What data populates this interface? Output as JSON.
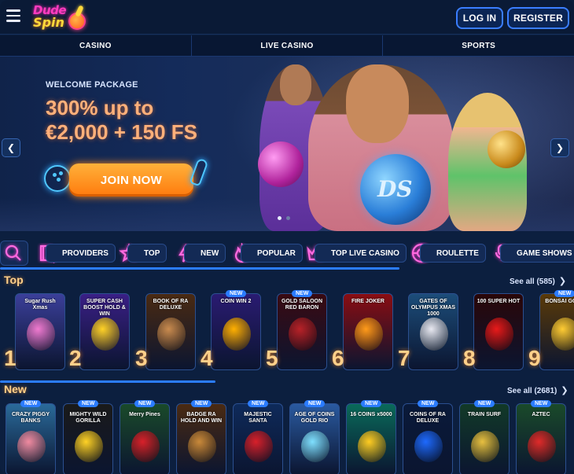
{
  "header": {
    "logo_line1": "Dude",
    "logo_line2": "Spin",
    "login_label": "LOG IN",
    "register_label": "REGISTER"
  },
  "nav": {
    "items": [
      {
        "label": "CASINO"
      },
      {
        "label": "LIVE CASINO"
      },
      {
        "label": "SPORTS"
      }
    ]
  },
  "banner": {
    "eyebrow": "WELCOME PACKAGE",
    "headline_line1": "300% up to",
    "headline_line2": "€2,000 + 150 FS",
    "cta_label": "JOIN NOW",
    "ball_logo": "DS",
    "slide_count": 2,
    "active_slide": 1
  },
  "categories": [
    {
      "label": "PROVIDERS",
      "icon": "book-icon"
    },
    {
      "label": "TOP",
      "icon": "star-icon"
    },
    {
      "label": "NEW",
      "icon": "lightning-icon"
    },
    {
      "label": "POPULAR",
      "icon": "fire-icon"
    },
    {
      "label": "TOP LIVE CASINO",
      "icon": "crown-icon"
    },
    {
      "label": "ROULETTE",
      "icon": "roulette-icon"
    },
    {
      "label": "GAME SHOWS",
      "icon": "microphone-icon"
    }
  ],
  "top_section": {
    "title": "Top",
    "see_all": "See all (585)",
    "badge_label": "NEW",
    "games": [
      {
        "rank": "1",
        "title": "Sugar Rush Xmas",
        "bg": "#3b3f9a",
        "art": "#f07ad0"
      },
      {
        "rank": "2",
        "title": "SUPER CASH BOOST HOLD & WIN",
        "bg": "#3a1f86",
        "art": "#ffd226"
      },
      {
        "rank": "3",
        "title": "BOOK OF RA DELUXE",
        "bg": "#4a2a12",
        "art": "#c98b4f"
      },
      {
        "rank": "4",
        "title": "COIN WIN 2",
        "bg": "#2a1b72",
        "art": "#ffb000",
        "new": true
      },
      {
        "rank": "5",
        "title": "GOLD SALOON RED BARON",
        "bg": "#3a0a12",
        "art": "#b82228",
        "new": true
      },
      {
        "rank": "6",
        "title": "FIRE JOKER",
        "bg": "#8a0d12",
        "art": "#ff9b1a"
      },
      {
        "rank": "7",
        "title": "GATES OF OLYMPUS XMAS 1000",
        "bg": "#1c4d7a",
        "art": "#e8e8f0"
      },
      {
        "rank": "8",
        "title": "100 SUPER HOT",
        "bg": "#2a0608",
        "art": "#e81a1a"
      },
      {
        "rank": "9",
        "title": "BONSAI GOLD",
        "bg": "#5a3a08",
        "art": "#ffcc33",
        "new": true
      }
    ]
  },
  "new_section": {
    "title": "New",
    "see_all": "See all (2681)",
    "badge_label": "NEW",
    "games": [
      {
        "title": "CRAZY PIGGY BANKS",
        "bg": "#2a6a9a",
        "art": "#f08aa0"
      },
      {
        "title": "MIGHTY WILD GORILLA",
        "bg": "#1a1a1a",
        "art": "#ffd226"
      },
      {
        "title": "Merry Pines",
        "bg": "#1a4a2a",
        "art": "#d8202a"
      },
      {
        "title": "BADGE RA HOLD AND WIN",
        "bg": "#4a2a12",
        "art": "#c9893a"
      },
      {
        "title": "MAJESTIC SANTA",
        "bg": "#0e2a5a",
        "art": "#d8202a"
      },
      {
        "title": "AGE OF COINS GOLD RIO",
        "bg": "#2a5aa0",
        "art": "#7fe0ff"
      },
      {
        "title": "16 COINS x5000",
        "bg": "#0a6a5a",
        "art": "#ffcc22"
      },
      {
        "title": "COINS OF RA DELUXE",
        "bg": "#0a1a3a",
        "art": "#1e6aff"
      },
      {
        "title": "TRAIN SURF",
        "bg": "#123a28",
        "art": "#e8c040"
      },
      {
        "title": "AZTEC",
        "bg": "#1a4a2a",
        "art": "#e02a2a"
      }
    ]
  },
  "colors": {
    "accent_blue": "#2b7cff",
    "cta_orange": "#ff8a1a",
    "title_orange": "#ffd08a"
  }
}
